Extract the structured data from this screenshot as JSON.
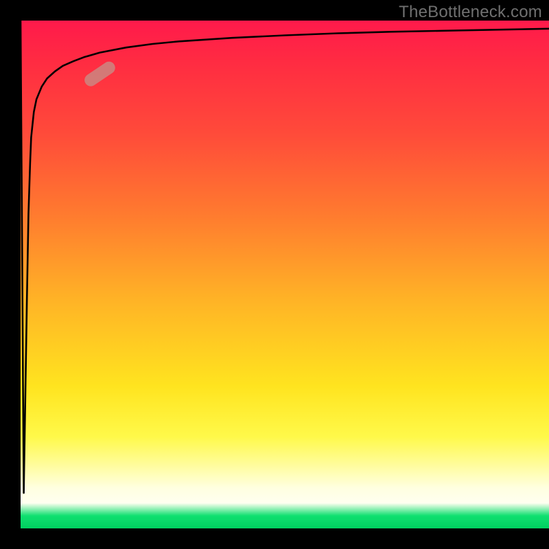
{
  "watermark": "TheBottleneck.com",
  "chart_data": {
    "type": "line",
    "title": "",
    "xlabel": "",
    "ylabel": "",
    "xlim": [
      0,
      100
    ],
    "ylim": [
      0,
      100
    ],
    "grid": false,
    "series": [
      {
        "name": "curve",
        "x": [
          0.0,
          0.6,
          1.2,
          1.5,
          1.8,
          2.0,
          2.5,
          3.0,
          4.0,
          5.0,
          6.5,
          8.0,
          10.0,
          12.0,
          15.0,
          20.0,
          25.0,
          30.0,
          40.0,
          50.0,
          60.0,
          70.0,
          80.0,
          90.0,
          100.0
        ],
        "y": [
          100.0,
          7.0,
          45.0,
          62.0,
          72.0,
          77.0,
          82.0,
          84.5,
          87.0,
          88.6,
          90.0,
          91.1,
          92.0,
          92.8,
          93.7,
          94.7,
          95.4,
          95.9,
          96.6,
          97.1,
          97.5,
          97.8,
          98.0,
          98.2,
          98.4
        ]
      }
    ],
    "marker": {
      "x": 15.0,
      "y": 89.5,
      "angle_deg": -34
    },
    "background_gradient": {
      "direction": "vertical",
      "stops": [
        {
          "pos": 0.0,
          "color": "#ff1a4b"
        },
        {
          "pos": 0.22,
          "color": "#ff4a3a"
        },
        {
          "pos": 0.55,
          "color": "#ffb326"
        },
        {
          "pos": 0.82,
          "color": "#fff94a"
        },
        {
          "pos": 0.94,
          "color": "#ffffe8"
        },
        {
          "pos": 1.0,
          "color": "#00d060"
        }
      ]
    }
  }
}
